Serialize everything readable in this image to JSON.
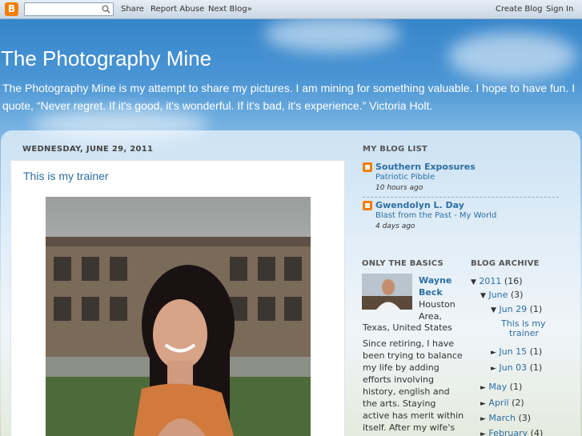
{
  "navbar": {
    "logo": "B",
    "search_placeholder": "",
    "share": "Share",
    "report_abuse": "Report Abuse",
    "next_blog": "Next Blog»",
    "create_blog": "Create Blog",
    "sign_in": "Sign In"
  },
  "header": {
    "title": "The Photography Mine",
    "description": "The Photography Mine is my attempt to share my pictures. I am mining for something valuable. I hope to have fun. I quote, “Never regret. If it's good, it's wonderful. If it's bad, it's experience.” Victoria Holt."
  },
  "post": {
    "date": "WEDNESDAY, JUNE 29, 2011",
    "title": "This is my trainer"
  },
  "blog_list": {
    "heading": "MY BLOG LIST",
    "items": [
      {
        "name": "Southern Exposures",
        "post": "Patriotic Pibble",
        "time": "10 hours ago"
      },
      {
        "name": "Gwendolyn L. Day",
        "post": "Blast from the Past - My World",
        "time": "4 days ago"
      }
    ]
  },
  "profile": {
    "heading": "ONLY THE BASICS",
    "name_line1": "Wayne",
    "name_line2": "Beck",
    "loc_line1": "Houston",
    "loc_line2": "Area,",
    "loc_line3": "Texas, United States",
    "bio": [
      "Since retiring, I have",
      "been trying to balance",
      "my life by adding",
      "efforts involving",
      "history, english and",
      "the arts. Staying",
      "active has merit within",
      "itself. After my wife's"
    ]
  },
  "archive": {
    "heading": "BLOG ARCHIVE",
    "year": {
      "label": "2011",
      "count": "(16)",
      "toggle": "▼"
    },
    "june": {
      "label": "June",
      "count": "(3)",
      "toggle": "▼"
    },
    "jun29": {
      "label": "Jun 29",
      "count": "(1)",
      "toggle": "▼"
    },
    "post_line1": "This is my",
    "post_line2": "trainer",
    "jun15": {
      "label": "Jun 15",
      "count": "(1)",
      "toggle": "►"
    },
    "jun03": {
      "label": "Jun 03",
      "count": "(1)",
      "toggle": "►"
    },
    "months": [
      {
        "label": "May",
        "count": "(1)",
        "toggle": "►"
      },
      {
        "label": "April",
        "count": "(2)",
        "toggle": "►"
      },
      {
        "label": "March",
        "count": "(3)",
        "toggle": "►"
      },
      {
        "label": "February",
        "count": "(4)",
        "toggle": "►"
      }
    ]
  },
  "colors": {
    "link": "#2d6fa3",
    "blogger_orange": "#f57d00",
    "sky": "#4a95d4"
  }
}
